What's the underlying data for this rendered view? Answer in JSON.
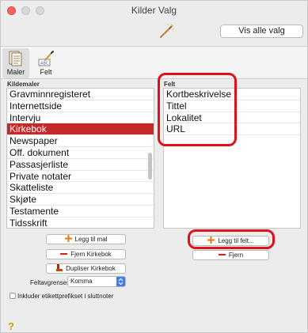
{
  "window": {
    "title": "Kilder Valg"
  },
  "toolbar": {
    "show_all_label": "Vis alle valg"
  },
  "tabs": [
    {
      "label": "Maler",
      "icon": "templates-icon",
      "active": true
    },
    {
      "label": "Felt",
      "icon": "field-icon",
      "active": false
    }
  ],
  "templates": {
    "header": "Kildemaler",
    "items": [
      "Gravminnregisteret",
      "Internettside",
      "Intervju",
      "Kirkebok",
      "Newspaper",
      "Off. dokument",
      "Passasjerliste",
      "Private notater",
      "Skatteliste",
      "Skjøte",
      "Testamente",
      "Tidsskrift"
    ],
    "selected": "Kirkebok",
    "buttons": {
      "add": "Legg til mal",
      "remove": "Fjern Kirkebok",
      "duplicate": "Dupliser Kirkebok"
    }
  },
  "fields": {
    "header": "Felt",
    "items": [
      "Kortbeskrivelse",
      "Tittel",
      "Lokalitet",
      "URL"
    ],
    "buttons": {
      "add": "Legg til felt...",
      "remove": "Fjern"
    }
  },
  "separator": {
    "label": "Feltavgrenser:",
    "value": "Komma"
  },
  "include_label_prefix": {
    "label": "Inkluder etikettprefikset i sluttnoter",
    "checked": false
  },
  "help": "?",
  "colors": {
    "selection": "#c32a2a",
    "annotation": "#e0111a",
    "accent": "#3a7ef2"
  }
}
